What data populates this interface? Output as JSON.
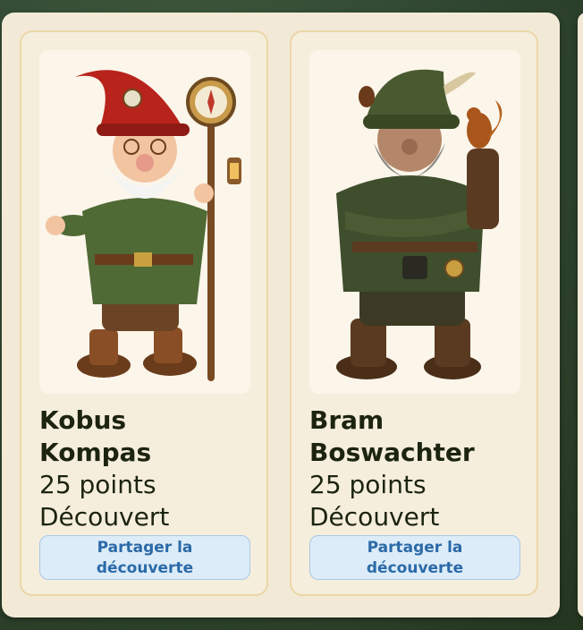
{
  "cards": [
    {
      "name_line1": "Kobus",
      "name_line2": "Kompas",
      "points": "25 points",
      "status": "Découvert",
      "share_label_line1": "Partager la",
      "share_label_line2": "découverte",
      "image_icon": "gnome-with-compass-staff"
    },
    {
      "name_line1": "Bram",
      "name_line2": "Boswachter",
      "points": "25 points",
      "status": "Découvert",
      "share_label_line1": "Partager la",
      "share_label_line2": "découverte",
      "image_icon": "gnome-with-squirrel"
    }
  ],
  "colors": {
    "background": "#2f4530",
    "panel": "#f2ead7",
    "card_border": "#ecd6a8",
    "text": "#1c2410",
    "button_bg": "#dcecf8",
    "button_text": "#2b6aa8"
  }
}
